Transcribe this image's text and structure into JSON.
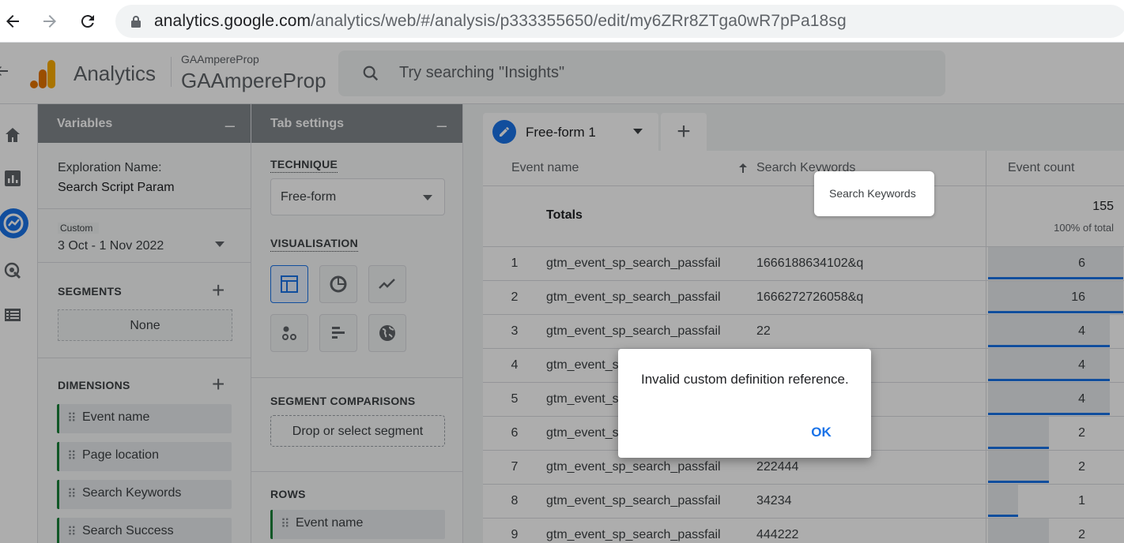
{
  "browser": {
    "url_host": "analytics.google.com",
    "url_path": "/analytics/web/#/analysis/p333355650/edit/my6ZRr8ZTga0wR7pPa18sg"
  },
  "header": {
    "app_name": "Analytics",
    "account_small": "GAAmpereProp",
    "account_large": "GAAmpereProp",
    "search_placeholder": "Try searching \"Insights\""
  },
  "variables": {
    "title": "Variables",
    "collapse": "–",
    "exploration_name_label": "Exploration Name:",
    "exploration_name": "Search Script Param",
    "date_tag": "Custom",
    "date_range": "3 Oct - 1 Nov 2022",
    "segments_title": "SEGMENTS",
    "segments_value": "None",
    "dimensions_title": "DIMENSIONS",
    "dimensions": [
      "Event name",
      "Page location",
      "Search Keywords",
      "Search Success"
    ]
  },
  "tab_settings": {
    "title": "Tab settings",
    "collapse": "–",
    "technique_title": "TECHNIQUE",
    "technique_value": "Free-form",
    "visualisation_title": "VISUALISATION",
    "segment_comparisons_title": "SEGMENT COMPARISONS",
    "segment_drop": "Drop or select segment",
    "rows_title": "ROWS",
    "rows_chip": "Event name"
  },
  "main": {
    "tab_label": "Free-form 1",
    "columns": {
      "event_name": "Event name",
      "search_keywords": "Search Keywords",
      "event_count": "Event count"
    },
    "totals_label": "Totals",
    "totals_value": "155",
    "totals_pct": "100% of total",
    "rows": [
      {
        "idx": "1",
        "event": "gtm_event_sp_search_passfail",
        "keyword": "1666188634102&q",
        "count": "6",
        "share": 1.0
      },
      {
        "idx": "2",
        "event": "gtm_event_sp_search_passfail",
        "keyword": "1666272726058&q",
        "count": "16",
        "share": 1.0
      },
      {
        "idx": "3",
        "event": "gtm_event_sp_search_passfail",
        "keyword": "22",
        "count": "4",
        "share": 0.9
      },
      {
        "idx": "4",
        "event": "gtm_event_s",
        "keyword": "",
        "count": "4",
        "share": 0.9
      },
      {
        "idx": "5",
        "event": "gtm_event_s",
        "keyword": "",
        "count": "4",
        "share": 0.9
      },
      {
        "idx": "6",
        "event": "gtm_event_s",
        "keyword": "",
        "count": "2",
        "share": 0.45
      },
      {
        "idx": "7",
        "event": "gtm_event_sp_search_passfail",
        "keyword": "222444",
        "count": "2",
        "share": 0.45
      },
      {
        "idx": "8",
        "event": "gtm_event_sp_search_passfail",
        "keyword": "34234",
        "count": "1",
        "share": 0.22
      },
      {
        "idx": "9",
        "event": "gtm_event_sp_search_passfail",
        "keyword": "444222",
        "count": "2",
        "share": 0.45
      }
    ],
    "tooltip": "Search Keywords"
  },
  "dialog": {
    "message": "Invalid custom definition reference.",
    "ok": "OK"
  },
  "colors": {
    "accent": "#1a73e8",
    "chip_border": "#188038",
    "logo_orange": "#f9ab00",
    "logo_dark": "#e37400"
  }
}
